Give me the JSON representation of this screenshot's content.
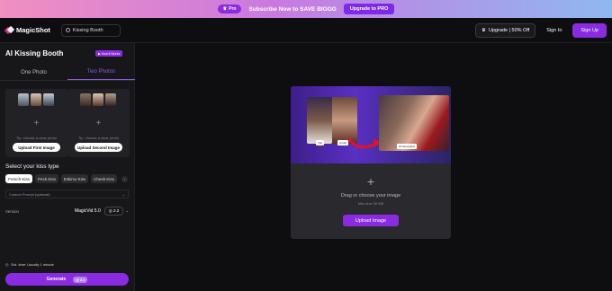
{
  "promo": {
    "pro_label": "Pro",
    "text_prefix": "Subscribe Now to",
    "text_highlight": "SAVE BIGGG",
    "upgrade_label": "Upgrade to PRO"
  },
  "header": {
    "logo_text": "MagicShot",
    "tool_select": "Kissing Booth",
    "upgrade_label": "Upgrade | 50% Off",
    "signin_label": "Sign In",
    "signup_label": "Sign Up"
  },
  "sidebar": {
    "title": "AI Kissing Booth",
    "how_it_works": "How it Works",
    "tabs": [
      {
        "label": "One Photo",
        "active": false
      },
      {
        "label": "Two Photos",
        "active": true
      }
    ],
    "uploads": [
      {
        "tip": "Tip: choose a clear photo",
        "button": "Upload First Image"
      },
      {
        "tip": "Tip: choose a clear photo",
        "button": "Upload Second Image"
      }
    ],
    "kiss_type_label": "Select your kiss type",
    "kiss_types": [
      {
        "label": "French Kiss",
        "active": true
      },
      {
        "label": "Peck Kiss",
        "active": false
      },
      {
        "label": "Eskimo Kiss",
        "active": false
      },
      {
        "label": "Cheek Kiss",
        "active": false
      }
    ],
    "custom_prompt_placeholder": "Custom Prompt (optional)",
    "version_label": "Version",
    "version_value": "MagicVid 5.0",
    "version_credits": "2.2",
    "est_time": "Est. time: Usually 1 minute",
    "generate_label": "Generate",
    "generate_credits": "2.2"
  },
  "main": {
    "preview_labels": [
      "You",
      "Crush",
      "AI Generated"
    ],
    "drop_text": "Drag or choose your image",
    "max_size": "Max size 30 MB",
    "upload_button": "Upload Image"
  },
  "colors": {
    "accent": "#8a2be2",
    "background": "#0e0e10",
    "panel": "#17171a"
  }
}
